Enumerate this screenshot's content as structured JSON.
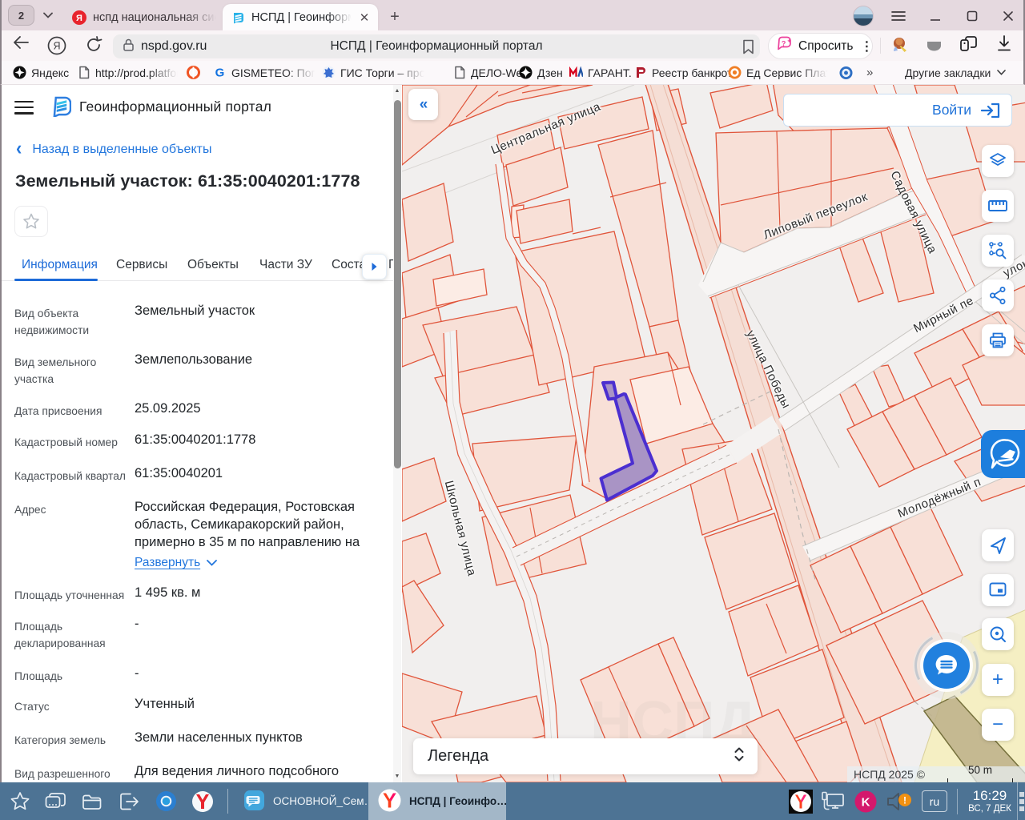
{
  "browser": {
    "tab_counter": "2",
    "tabs": [
      {
        "title": "нспд национальная систе",
        "active": false
      },
      {
        "title": "НСПД | Геоинформаци",
        "active": true
      }
    ],
    "new_tab_label": "+",
    "url": "nspd.gov.ru",
    "omnibox_page_title": "НСПД | Геоинформационный портал",
    "ask_button_label": "Спросить",
    "bookmarks": [
      {
        "label": "Яндекс"
      },
      {
        "label": "http://prod.platfor"
      },
      {
        "label": ""
      },
      {
        "label": "GISMETEO: Погод"
      },
      {
        "label": "ГИС Торги – прод"
      },
      {
        "label": "ДЕЛО-Web"
      },
      {
        "label": "Дзен"
      },
      {
        "label": "ГАРАНТ."
      },
      {
        "label": "Реестр банкрот"
      },
      {
        "label": "Ед Сервис Плат"
      },
      {
        "label": ""
      }
    ],
    "bookmarks_overflow": "»",
    "other_bookmarks_label": "Другие закладки"
  },
  "panel": {
    "app_title": "Геоинформационный портал",
    "back_link": "Назад в выделенные объекты",
    "object_title": "Земельный участок: 61:35:0040201:1778",
    "tabs": [
      {
        "label": "Информация",
        "active": true
      },
      {
        "label": "Сервисы",
        "active": false
      },
      {
        "label": "Объекты",
        "active": false
      },
      {
        "label": "Части ЗУ",
        "active": false
      },
      {
        "label": "Соста",
        "active": false
      },
      {
        "label": "Г",
        "active": false
      }
    ],
    "fields": [
      {
        "label": "Вид объекта недвижимости",
        "value": "Земельный участок"
      },
      {
        "label": "Вид земельного участка",
        "value": "Землепользование"
      },
      {
        "label": "Дата присвоения",
        "value": "25.09.2025"
      },
      {
        "label": "Кадастровый номер",
        "value": "61:35:0040201:1778"
      },
      {
        "label": "Кадастровый квартал",
        "value": "61:35:0040201"
      },
      {
        "label": "Адрес",
        "value": "Российская Федерация, Ростовская область, Семикаракорский район, примерно в 35 м по направлению на",
        "expand_label": "Развернуть"
      },
      {
        "label": "Площадь уточненная",
        "value": "1 495 кв. м"
      },
      {
        "label": "Площадь декларированная",
        "value": "-"
      },
      {
        "label": "Площадь",
        "value": "-"
      },
      {
        "label": "Статус",
        "value": "Учтенный"
      },
      {
        "label": "Категория земель",
        "value": "Земли населенных пунктов"
      },
      {
        "label": "Вид разрешенного",
        "value": "Для ведения личного подсобного"
      }
    ]
  },
  "map": {
    "login_label": "Войти",
    "legend_label": "Легенда",
    "attribution": "НСПД 2025 ©",
    "scale_label": "50 m",
    "selected_parcel": "61:35:0040201:1778",
    "street_labels": [
      "Центральная  улица",
      "Садовая  улица",
      "Липовый  переулок",
      "Мирный  пе",
      "улок",
      "улица  Победы",
      "Школьная  улица",
      "Молодёжный  п"
    ]
  },
  "colors": {
    "accent_blue": "#1f72d8",
    "link_blue": "#2276dd",
    "parcel_fill": "#f8e0d7",
    "parcel_fill_light": "#fcece5",
    "parcel_stroke": "#e0553b",
    "road_band_fill": "#f5ded5",
    "selected_parcel_fill": "rgba(104,86,183,0.55)",
    "selected_parcel_stroke": "#4b2fd0",
    "map_background": "#f1efee",
    "taskbar_background": "#4d7394"
  },
  "taskbar": {
    "apps": [
      {
        "label": "ОСНОВНОЙ_Сем…",
        "active": false
      },
      {
        "label": "НСПД | Геоинфо…",
        "active": true
      }
    ],
    "language": "ru",
    "time": "16:29",
    "date": "ВС, 7 ДЕК"
  }
}
